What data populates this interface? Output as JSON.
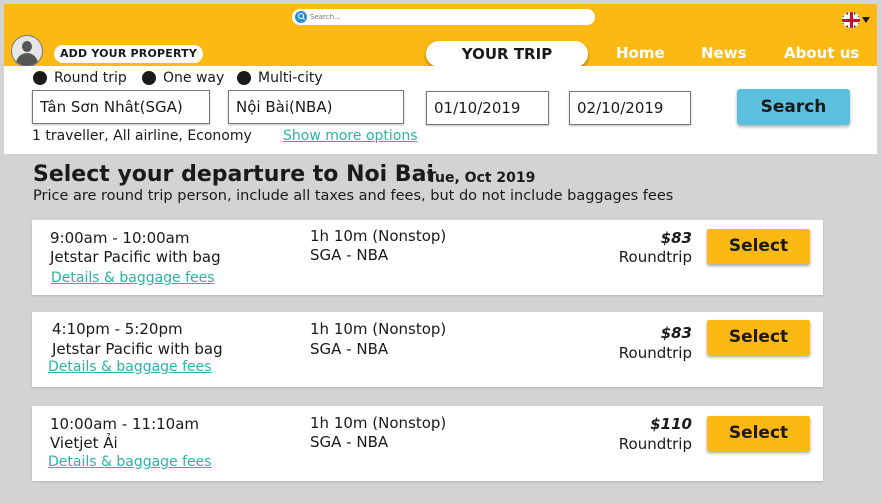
{
  "header": {
    "search_placeholder": "Search...",
    "add_property_label": "ADD YOUR PROPERTY",
    "your_trip_label": "YOUR TRIP",
    "nav": [
      "Home",
      "News",
      "About us"
    ],
    "language_icon": "uk-flag-icon",
    "accent_color": "#fdb913"
  },
  "search_form": {
    "trip_types": [
      "Round trip",
      "One way",
      "Multi-city"
    ],
    "from": "Tân Sơn Nhât(SGA)",
    "to": "Nội Bài(NBA)",
    "depart_date": "01/10/2019",
    "return_date": "02/10/2019",
    "search_label": "Search",
    "travellers_summary": "1 traveller, All airline, Economy",
    "more_options_label": "Show more options"
  },
  "results": {
    "title": "Select your departure to Noi Bai",
    "date": "Tue, Oct 2019",
    "subtitle": "Price are round trip person, include all taxes and fees, but do not include baggages fees",
    "flights": [
      {
        "time": "9:00am - 10:00am",
        "airline": "Jetstar  Pacific with bag",
        "details_label": "Details & baggage fees ",
        "duration": "1h 10m (Nonstop)",
        "route": "SGA - NBA",
        "price": "$83",
        "price_type": "Roundtrip",
        "select_label": "Select"
      },
      {
        "time": "4:10pm - 5:20pm",
        "airline": "Jetstar Pacific with bag",
        "details_label": "Details & baggage fees ",
        "duration": "1h 10m (Nonstop)",
        "route": "SGA - NBA",
        "price": "$83",
        "price_type": "Roundtrip",
        "select_label": "Select"
      },
      {
        "time": "10:00am - 11:10am",
        "airline": "Vietjet Ải",
        "details_label": "Details & baggage fees ",
        "duration": "1h 10m (Nonstop)",
        "route": "SGA - NBA",
        "price": "$110",
        "price_type": "Roundtrip",
        "select_label": "Select"
      }
    ]
  }
}
